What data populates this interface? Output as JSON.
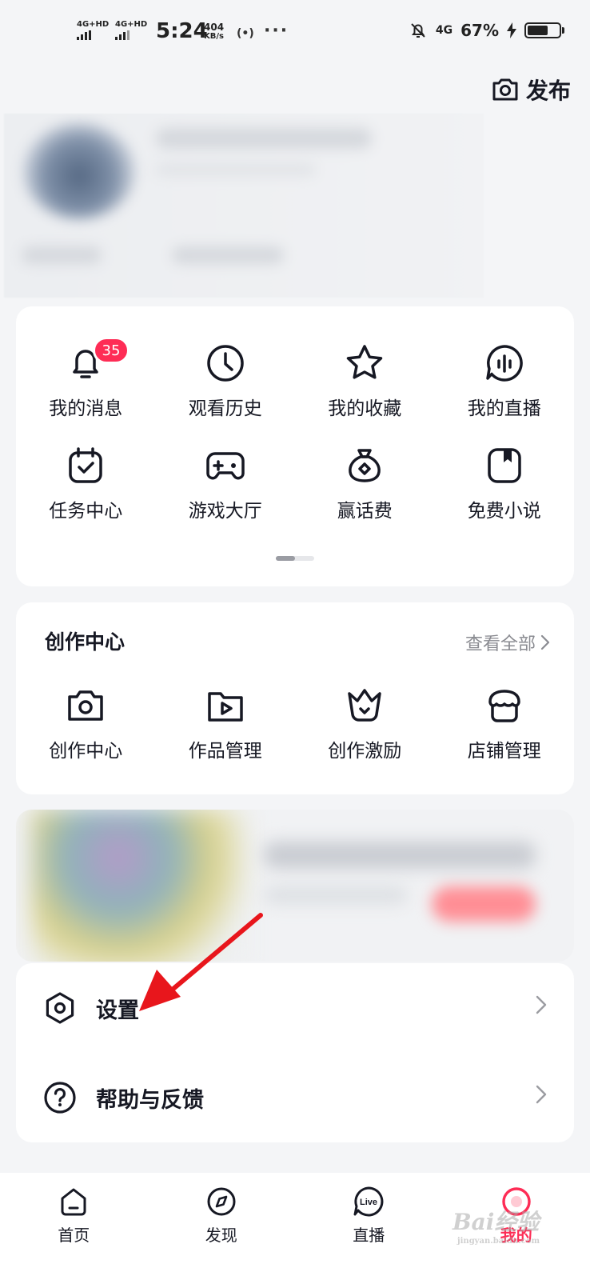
{
  "status_bar": {
    "signal1_label": "4G+HD",
    "signal2_label": "4G+HD",
    "time": "5:24",
    "net_speed_value": "404",
    "net_speed_unit": "KB/s",
    "network_type": "4G",
    "battery_percent": "67%",
    "battery_level": 0.67
  },
  "header": {
    "publish_label": "发布"
  },
  "quick_menu": {
    "items": [
      {
        "label": "我的消息",
        "icon": "bell-icon",
        "badge": "35"
      },
      {
        "label": "观看历史",
        "icon": "clock-icon"
      },
      {
        "label": "我的收藏",
        "icon": "star-icon"
      },
      {
        "label": "我的直播",
        "icon": "live-waveform-icon"
      },
      {
        "label": "任务中心",
        "icon": "calendar-check-icon"
      },
      {
        "label": "游戏大厅",
        "icon": "gamepad-icon"
      },
      {
        "label": "赢话费",
        "icon": "money-bag-icon"
      },
      {
        "label": "免费小说",
        "icon": "book-icon"
      }
    ]
  },
  "creator_center": {
    "title": "创作中心",
    "view_all": "查看全部",
    "items": [
      {
        "label": "创作中心",
        "icon": "camera-icon"
      },
      {
        "label": "作品管理",
        "icon": "folder-play-icon"
      },
      {
        "label": "创作激励",
        "icon": "crown-icon"
      },
      {
        "label": "店铺管理",
        "icon": "shop-icon"
      }
    ]
  },
  "settings_list": {
    "items": [
      {
        "label": "设置",
        "icon": "hexagon-settings-icon"
      },
      {
        "label": "帮助与反馈",
        "icon": "question-circle-icon"
      }
    ]
  },
  "bottom_nav": {
    "items": [
      {
        "label": "首页",
        "icon": "home-icon"
      },
      {
        "label": "发现",
        "icon": "compass-icon"
      },
      {
        "label": "直播",
        "icon": "live-icon",
        "icon_text": "Live"
      },
      {
        "label": "我的",
        "icon": "profile-icon",
        "active": true
      }
    ]
  },
  "watermark": {
    "text": "Bai经验",
    "sub": "jingyan.baidu.com"
  },
  "colors": {
    "accent": "#fe2c55",
    "background": "#f4f5f7",
    "annotation_arrow": "#e8161c"
  }
}
